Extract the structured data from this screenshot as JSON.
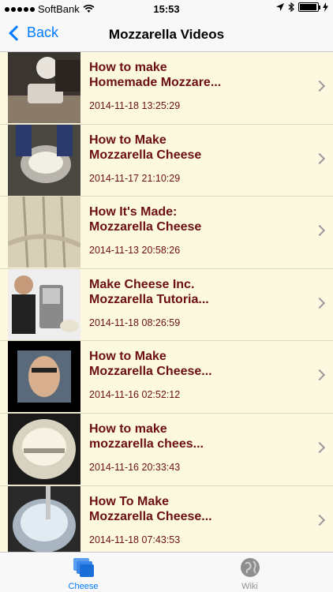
{
  "status": {
    "carrier": "SoftBank",
    "time": "15:53",
    "battery_level": 0.95
  },
  "nav": {
    "back_label": "Back",
    "title": "Mozzarella Videos"
  },
  "videos": [
    {
      "title": "How to make\nHomemade Mozzare...",
      "date": "2014-11-18 13:25:29"
    },
    {
      "title": "How to Make\nMozzarella Cheese",
      "date": "2014-11-17 21:10:29"
    },
    {
      "title": "How It's Made:\nMozzarella Cheese",
      "date": "2014-11-13 20:58:26"
    },
    {
      "title": "Make Cheese Inc.\nMozzarella Tutoria...",
      "date": "2014-11-18 08:26:59"
    },
    {
      "title": "How to Make\nMozzarella Cheese...",
      "date": "2014-11-16 02:52:12"
    },
    {
      "title": "How to make\nmozzarella chees...",
      "date": "2014-11-16 20:33:43"
    },
    {
      "title": "How To Make\nMozzarella Cheese...",
      "date": "2014-11-18 07:43:53"
    }
  ],
  "tabs": [
    {
      "label": "Cheese",
      "icon": "cheese-stack-icon",
      "active": true
    },
    {
      "label": "Wiki",
      "icon": "globe-icon",
      "active": false
    }
  ],
  "colors": {
    "accent": "#007aff",
    "title_text": "#6b0f0f",
    "row_background": "#fdf9e1",
    "inactive_tab": "#929292"
  }
}
